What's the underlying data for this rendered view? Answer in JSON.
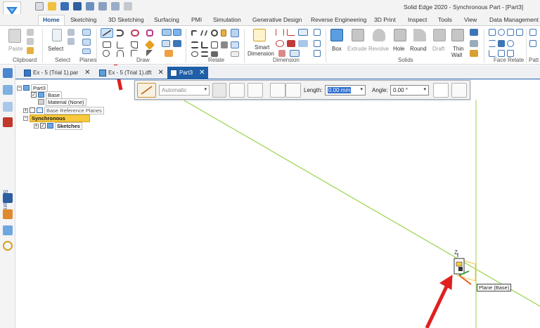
{
  "window": {
    "title": "Solid Edge 2020 - Synchronous Part - [Part3]"
  },
  "colors": {
    "accent": "#1f5fa8",
    "sync": "#f6c93f",
    "arrow": "#e02020",
    "grid": "#9ad24a"
  },
  "tabs": [
    "Home",
    "Sketching",
    "3D Sketching",
    "Surfacing",
    "PMI",
    "Simulation",
    "Generative Design",
    "Reverse Engineering",
    "3D Print",
    "Inspect",
    "Tools",
    "View",
    "Data Management"
  ],
  "ribbon": {
    "groups": {
      "clipboard": "Clipboard",
      "select": "Select",
      "planes": "Planes",
      "draw": "Draw",
      "relate": "Relate",
      "dimension": "Dimension",
      "solids": "Solids",
      "face_relate": "Face Relate",
      "patt": "Patt"
    },
    "buttons": {
      "paste": "Paste",
      "select": "Select",
      "smart_dimension_1": "Smart",
      "smart_dimension_2": "Dimension",
      "box": "Box",
      "extrude": "Extrude",
      "revolve": "Revolve",
      "hole": "Hole",
      "round": "Round",
      "draft": "Draft",
      "thin_wall_1": "Thin",
      "thin_wall_2": "Wall"
    }
  },
  "doc_tabs": [
    "Ex - 5 (Trial 1).par",
    "Ex - 5 (Trial 1).dft",
    "Part3"
  ],
  "dock": {
    "sensors": "Sensors"
  },
  "tree": {
    "root": "Part3",
    "base": "Base",
    "material": "Material (None)",
    "base_ref_planes": "Base Reference Planes",
    "synchronous": "Synchronous",
    "sketches": "Sketches"
  },
  "command_bar": {
    "mode": "Automatic",
    "length_label": "Length:",
    "length_value": "0.00 mm",
    "angle_label": "Angle:",
    "angle_value": "0.00 °"
  },
  "viewport": {
    "plane_tooltip": "Plane (Base)",
    "axis_z": "Z"
  }
}
